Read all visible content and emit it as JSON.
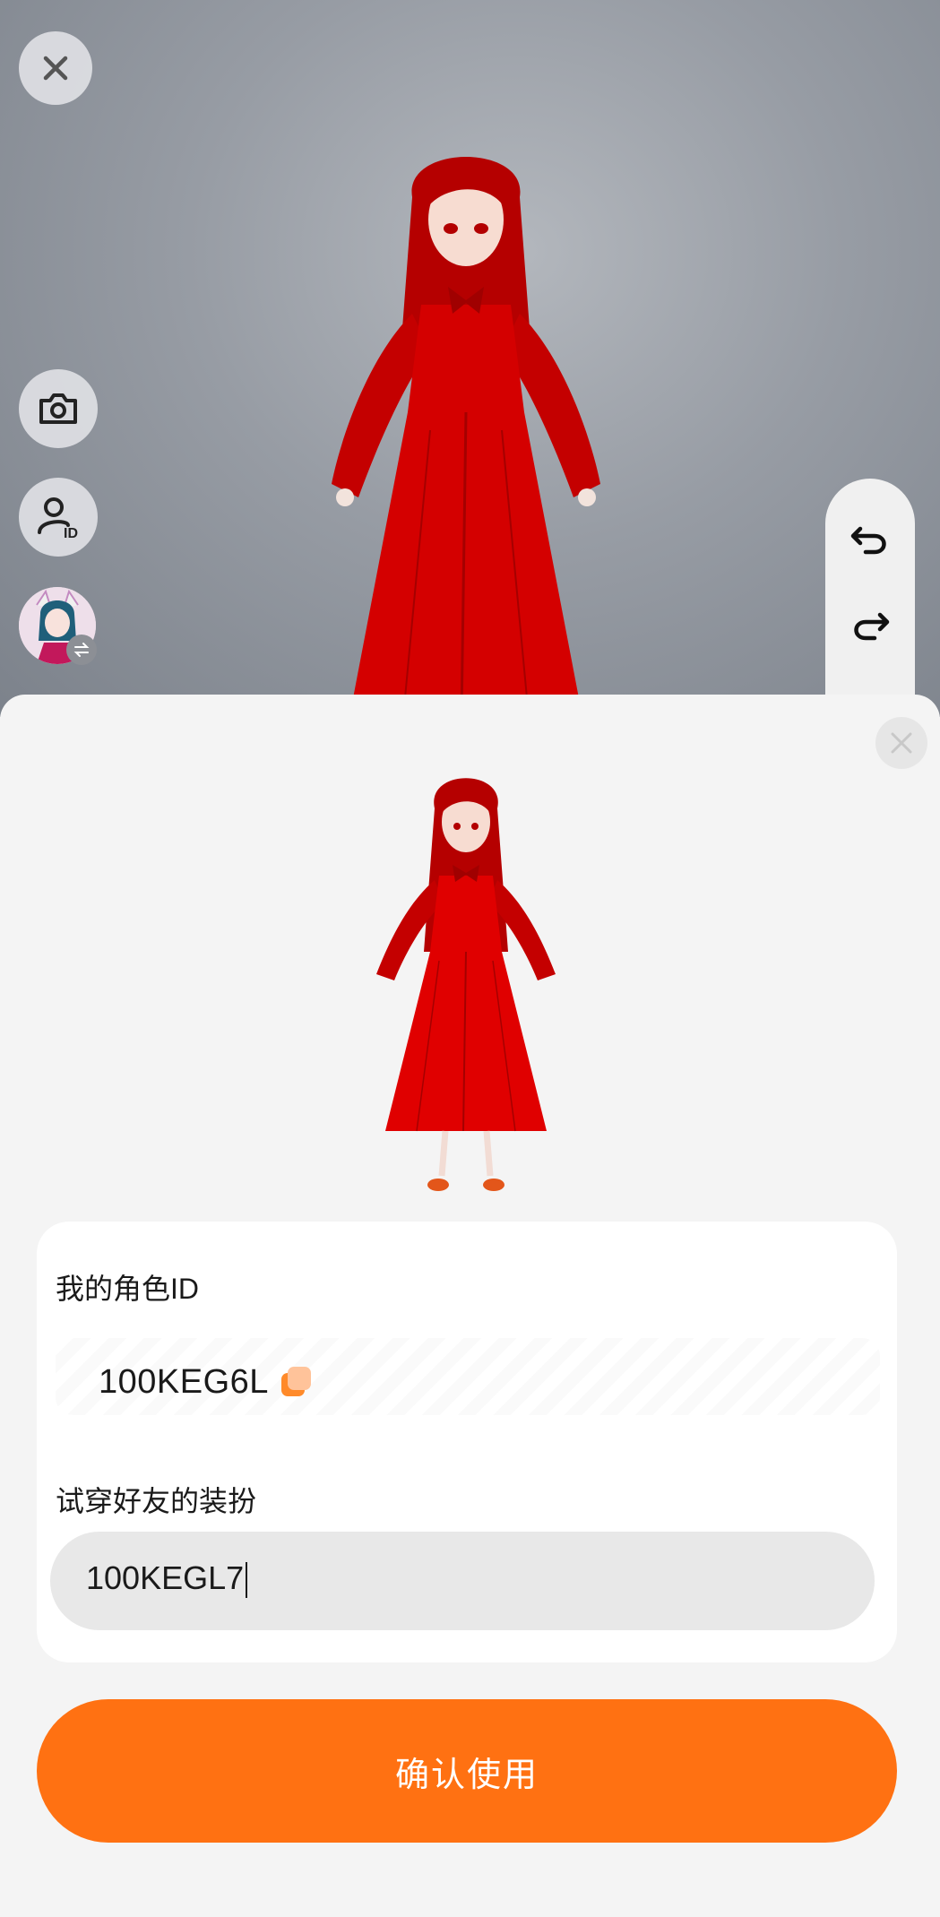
{
  "viewport": {
    "close_icon": "close-icon",
    "tools": [
      {
        "name": "camera-icon"
      },
      {
        "name": "avatar-id-icon",
        "badge": "ID"
      },
      {
        "name": "switch-avatar-icon"
      }
    ],
    "history": {
      "undo_icon": "undo-icon",
      "redo_icon": "redo-icon"
    }
  },
  "sheet": {
    "my_id_label": "我的角色ID",
    "my_id_value": "100KEG6L",
    "copy_icon": "copy-icon",
    "friend_label": "试穿好友的装扮",
    "friend_input_value": "100KEGL7",
    "confirm_label": "确认使用"
  },
  "colors": {
    "accent": "#ff7112",
    "dress_red": "#d40000",
    "card_bg": "#ffffff",
    "sheet_bg": "#f4f4f4",
    "input_bg": "#e8e8e8"
  }
}
